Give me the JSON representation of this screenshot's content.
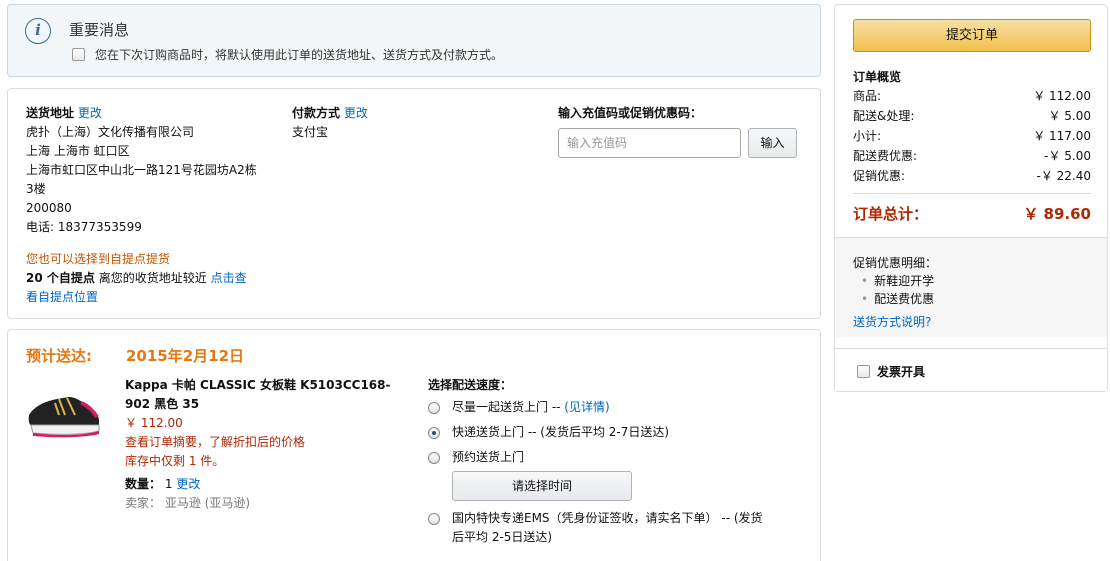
{
  "notice": {
    "title": "重要消息",
    "checkbox_text": "您在下次订购商品时，将默认使用此订单的送货地址、送货方式及付款方式。"
  },
  "address": {
    "label": "送货地址",
    "change": "更改",
    "lines": [
      "虎扑（上海）文化传播有限公司",
      "上海 上海市 虹口区",
      "上海市虹口区中山北一路121号花园坊A2栋",
      "3楼",
      "200080",
      "电话: 18377353599"
    ]
  },
  "payment": {
    "label": "付款方式",
    "change": "更改",
    "method": "支付宝"
  },
  "promo": {
    "label": "输入充值码或促销优惠码：",
    "placeholder": "输入充值码",
    "button": "输入"
  },
  "pickup": {
    "hint": "您也可以选择到自提点提货",
    "count": "20 个自提点",
    "near": "离您的收货地址较近",
    "click": "点击查",
    "view": "看自提点位置"
  },
  "shipment": {
    "eta_label": "预计送达:",
    "eta_date": "2015年2月12日",
    "product": {
      "title": "Kappa 卡帕 CLASSIC 女板鞋 K5103CC168-902 黑色 35",
      "price": "￥ 112.00",
      "summary_note": "查看订单摘要，了解折扣后的价格",
      "stock": "库存中仅剩 1 件。",
      "qty_label": "数量：",
      "qty": "1",
      "qty_change": "更改",
      "seller_label": "卖家：",
      "seller": "亚马逊 (亚马逊)"
    },
    "speed": {
      "label": "选择配送速度：",
      "options": [
        {
          "text": "尽量一起送货上门 -- ",
          "link": "(见详情)",
          "selected": false
        },
        {
          "text": "快递送货上门 --   (发货后平均 2-7日送达)",
          "selected": true
        },
        {
          "text": "预约送货上门",
          "selected": false
        },
        {
          "text": "国内特快专递EMS（凭身份证签收，请实名下单） --   (发货",
          "text2": "后平均 2-5日送达)",
          "selected": false
        }
      ],
      "time_button": "请选择时间"
    }
  },
  "summary": {
    "submit": "提交订单",
    "title": "订单概览",
    "rows": [
      {
        "k": "商品:",
        "v": "￥ 112.00"
      },
      {
        "k": "配送&处理:",
        "v": "￥ 5.00"
      },
      {
        "k": "小计:",
        "v": "￥ 117.00"
      },
      {
        "k": "配送费优惠:",
        "v": "-￥ 5.00"
      },
      {
        "k": "促销优惠:",
        "v": "-￥ 22.40"
      }
    ],
    "total_label": "订单总计：",
    "total_value": "￥ 89.60",
    "promo_detail_title": "促销优惠明细：",
    "promo_items": [
      "新鞋迎开学",
      "配送费优惠"
    ],
    "shipping_help": "送货方式说明?",
    "invoice": "发票开具"
  }
}
